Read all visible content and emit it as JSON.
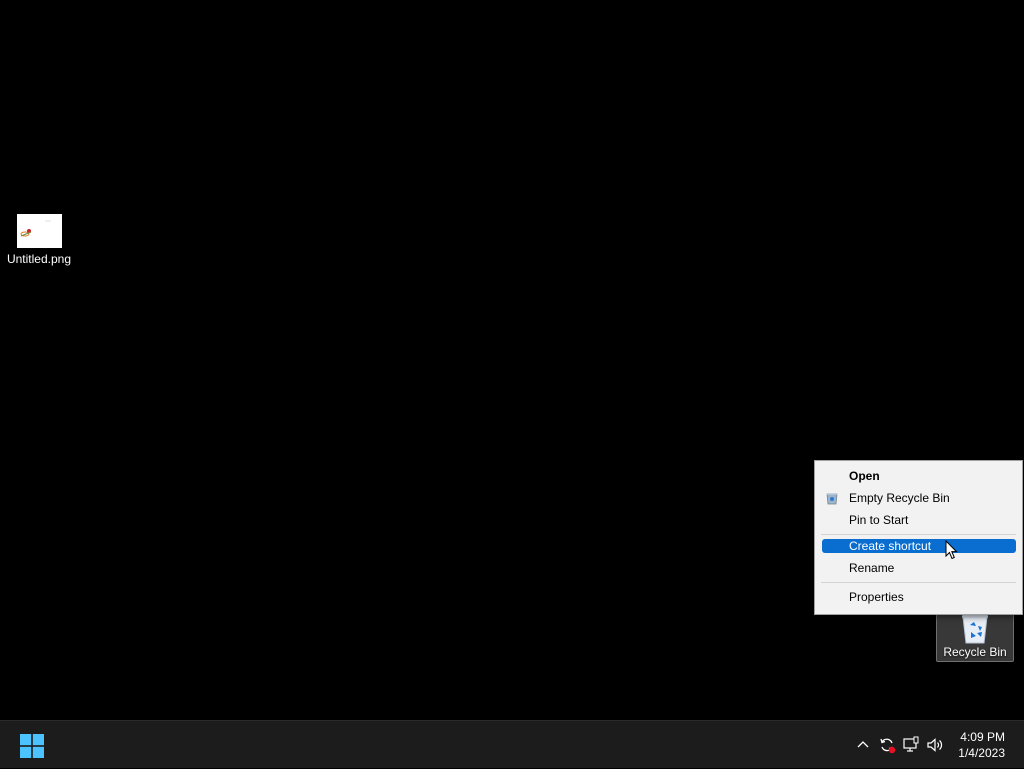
{
  "desktop": {
    "icons": [
      {
        "label": "Untitled.png",
        "icon": "image-file-icon"
      },
      {
        "label": "Recycle Bin",
        "icon": "recycle-bin-icon"
      }
    ]
  },
  "context_menu": {
    "items": [
      {
        "label": "Open",
        "bold": true
      },
      {
        "label": "Empty Recycle Bin",
        "icon": "recycle-bin-small-icon"
      },
      {
        "label": "Pin to Start"
      },
      {
        "label": "Create shortcut",
        "highlighted": true
      },
      {
        "label": "Rename"
      },
      {
        "label": "Properties"
      }
    ]
  },
  "taskbar": {
    "start": "windows-start-icon",
    "tray_icons": [
      "chevron-up-icon",
      "sync-icon",
      "network-icon",
      "volume-icon"
    ],
    "clock": {
      "time": "4:09 PM",
      "date": "1/4/2023"
    }
  },
  "colors": {
    "highlight": "#0a6ed1",
    "desktop": "#000000",
    "taskbar": "#1c1c1c"
  }
}
